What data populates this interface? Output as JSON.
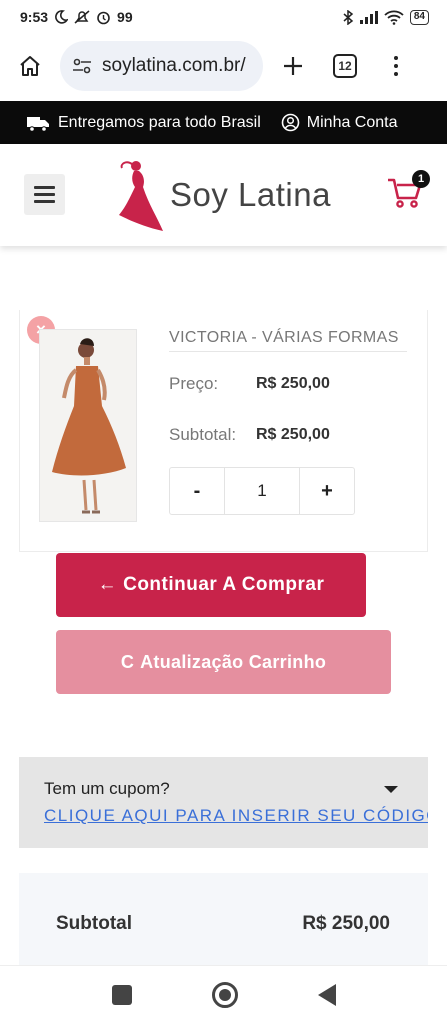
{
  "status": {
    "time": "9:53",
    "notif_count": "99",
    "battery": "84"
  },
  "browser": {
    "url": "soylatina.com.br/",
    "tab_count": "12"
  },
  "promo": {
    "shipping": "Entregamos para todo Brasil",
    "account": "Minha Conta"
  },
  "header": {
    "brand": "Soy Latina",
    "cart_count": "1"
  },
  "cart_item": {
    "name": "VICTORIA - VÁRIAS FORMAS",
    "price_label": "Preço:",
    "price": "R$ 250,00",
    "subtotal_label": "Subtotal:",
    "subtotal": "R$ 250,00",
    "quantity": "1",
    "minus": "-",
    "plus": "+",
    "remove": "×"
  },
  "buttons": {
    "continue": "Continuar A Comprar",
    "continue_icon": "←",
    "update": "Atualização Carrinho",
    "update_icon": "C"
  },
  "coupon": {
    "question": "Tem um cupom?",
    "link": "CLIQUE AQUI PARA INSERIR SEU CÓDIGO"
  },
  "totals": {
    "subtotal_label": "Subtotal",
    "subtotal": "R$ 250,00"
  },
  "colors": {
    "accent": "#c8234a",
    "accent_light": "#e58f9f",
    "promo_bg": "#0b0b0b"
  }
}
